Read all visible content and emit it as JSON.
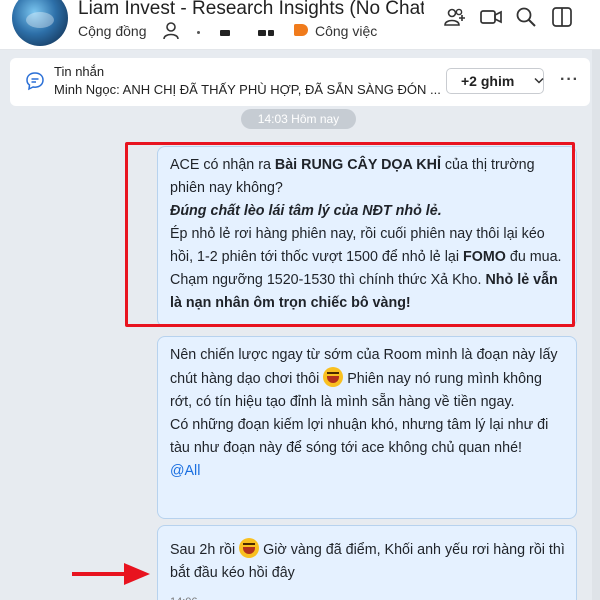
{
  "header": {
    "title": "Liam Invest - Research  Insights (No Chat)",
    "community_label": "Cộng đồng",
    "tag_label": "Công việc",
    "icons": [
      "group-add-icon",
      "video-call-icon",
      "search-icon",
      "sidebar-toggle-icon"
    ]
  },
  "pinned": {
    "title": "Tin nhắn",
    "text": "Minh Ngọc: ANH CHỊ ĐÃ THẤY PHÙ HỢP, ĐÃ SẴN SÀNG ĐÓN ...",
    "button_label": "+2 ghim",
    "more_label": "···"
  },
  "time_chip": "14:03 Hôm nay",
  "messages": [
    {
      "parts": {
        "t1": "ACE có nhận ra ",
        "t2": "Bài RUNG CÂY DỌA KHỈ",
        "t3": " của thị trường phiên nay không?",
        "t4": "Đúng chất lèo lái tâm lý của NĐT nhỏ lẻ.",
        "t5": "Ép nhỏ lẻ rơi hàng phiên nay, rồi cuối phiên nay thôi lại kéo hồi, 1-2 phiên tới thốc vượt 1500 để nhỏ lẻ lại ",
        "t6": "FOMO",
        "t7": " đu mua. Chạm ngưỡng 1520-1530 thì chính thức Xả Kho. ",
        "t8": "Nhỏ lẻ vẫn là nạn nhân ôm trọn chiếc bô vàng!"
      }
    },
    {
      "parts": {
        "t1": "Nên chiến lược ngay từ sớm của Room mình là đoạn này lấy chút hàng dạo chơi thôi ",
        "t2": " Phiên nay nó rung mình không rớt, có tín hiệu tạo đỉnh là mình sẵn hàng về tiền ngay.",
        "t3": "Có những đoạn kiếm lợi nhuận khó, nhưng tâm lý lại như đi tàu như đoạn này để sóng tới ace không chủ quan nhé!",
        "mention": "@All"
      }
    },
    {
      "parts": {
        "t1": "Sau 2h rồi ",
        "t2": " Giờ vàng đã điểm, Khối anh yếu rơi hàng rồi thì bắt đầu kéo hồi đây"
      },
      "time": "14:06"
    }
  ],
  "colors": {
    "bubble_bg": "#e5f1ff",
    "annotation_red": "#e8131f",
    "mention_blue": "#1a6fe0",
    "tag_orange": "#f07b1c"
  }
}
